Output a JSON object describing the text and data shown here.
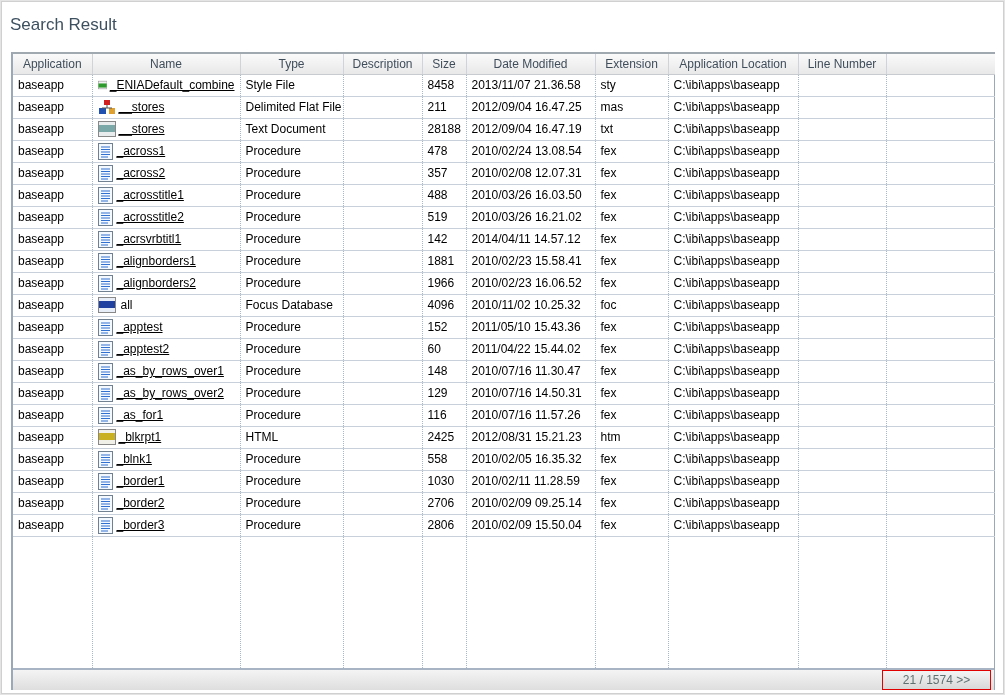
{
  "title": "Search Result",
  "table": {
    "columns": [
      "Application",
      "Name",
      "Type",
      "Description",
      "Size",
      "Date Modified",
      "Extension",
      "Application Location",
      "Line Number"
    ],
    "rows": [
      {
        "kind": "style",
        "linked": true,
        "cells": [
          "baseapp",
          "_ENIADefault_combine",
          "Style File",
          "",
          "8458",
          "2013/11/07 21.36.58",
          "sty",
          "C:\\ibi\\apps\\baseapp",
          ""
        ]
      },
      {
        "kind": "master",
        "linked": true,
        "cells": [
          "baseapp",
          "__stores",
          "Delimited Flat File",
          "",
          "211",
          "2012/09/04 16.47.25",
          "mas",
          "C:\\ibi\\apps\\baseapp",
          ""
        ]
      },
      {
        "kind": "text",
        "linked": true,
        "cells": [
          "baseapp",
          "__stores",
          "Text Document",
          "",
          "28188",
          "2012/09/04 16.47.19",
          "txt",
          "C:\\ibi\\apps\\baseapp",
          ""
        ]
      },
      {
        "kind": "procedure",
        "linked": true,
        "cells": [
          "baseapp",
          "_across1",
          "Procedure",
          "",
          "478",
          "2010/02/24 13.08.54",
          "fex",
          "C:\\ibi\\apps\\baseapp",
          ""
        ]
      },
      {
        "kind": "procedure",
        "linked": true,
        "cells": [
          "baseapp",
          "_across2",
          "Procedure",
          "",
          "357",
          "2010/02/08 12.07.31",
          "fex",
          "C:\\ibi\\apps\\baseapp",
          ""
        ]
      },
      {
        "kind": "procedure",
        "linked": true,
        "cells": [
          "baseapp",
          "_acrosstitle1",
          "Procedure",
          "",
          "488",
          "2010/03/26 16.03.50",
          "fex",
          "C:\\ibi\\apps\\baseapp",
          ""
        ]
      },
      {
        "kind": "procedure",
        "linked": true,
        "cells": [
          "baseapp",
          "_acrosstitle2",
          "Procedure",
          "",
          "519",
          "2010/03/26 16.21.02",
          "fex",
          "C:\\ibi\\apps\\baseapp",
          ""
        ]
      },
      {
        "kind": "procedure",
        "linked": true,
        "cells": [
          "baseapp",
          "_acrsvrbtitl1",
          "Procedure",
          "",
          "142",
          "2014/04/11 14.57.12",
          "fex",
          "C:\\ibi\\apps\\baseapp",
          ""
        ]
      },
      {
        "kind": "procedure",
        "linked": true,
        "cells": [
          "baseapp",
          "_alignborders1",
          "Procedure",
          "",
          "1881",
          "2010/02/23 15.58.41",
          "fex",
          "C:\\ibi\\apps\\baseapp",
          ""
        ]
      },
      {
        "kind": "procedure",
        "linked": true,
        "cells": [
          "baseapp",
          "_alignborders2",
          "Procedure",
          "",
          "1966",
          "2010/02/23 16.06.52",
          "fex",
          "C:\\ibi\\apps\\baseapp",
          ""
        ]
      },
      {
        "kind": "focus",
        "linked": false,
        "cells": [
          "baseapp",
          "all",
          "Focus Database",
          "",
          "4096",
          "2010/11/02 10.25.32",
          "foc",
          "C:\\ibi\\apps\\baseapp",
          ""
        ]
      },
      {
        "kind": "procedure",
        "linked": true,
        "cells": [
          "baseapp",
          "_apptest",
          "Procedure",
          "",
          "152",
          "2011/05/10 15.43.36",
          "fex",
          "C:\\ibi\\apps\\baseapp",
          ""
        ]
      },
      {
        "kind": "procedure",
        "linked": true,
        "cells": [
          "baseapp",
          "_apptest2",
          "Procedure",
          "",
          "60",
          "2011/04/22 15.44.02",
          "fex",
          "C:\\ibi\\apps\\baseapp",
          ""
        ]
      },
      {
        "kind": "procedure",
        "linked": true,
        "cells": [
          "baseapp",
          "_as_by_rows_over1",
          "Procedure",
          "",
          "148",
          "2010/07/16 11.30.47",
          "fex",
          "C:\\ibi\\apps\\baseapp",
          ""
        ]
      },
      {
        "kind": "procedure",
        "linked": true,
        "cells": [
          "baseapp",
          "_as_by_rows_over2",
          "Procedure",
          "",
          "129",
          "2010/07/16 14.50.31",
          "fex",
          "C:\\ibi\\apps\\baseapp",
          ""
        ]
      },
      {
        "kind": "procedure",
        "linked": true,
        "cells": [
          "baseapp",
          "_as_for1",
          "Procedure",
          "",
          "116",
          "2010/07/16 11.57.26",
          "fex",
          "C:\\ibi\\apps\\baseapp",
          ""
        ]
      },
      {
        "kind": "html",
        "linked": true,
        "cells": [
          "baseapp",
          "_blkrpt1",
          "HTML",
          "",
          "2425",
          "2012/08/31 15.21.23",
          "htm",
          "C:\\ibi\\apps\\baseapp",
          ""
        ]
      },
      {
        "kind": "procedure",
        "linked": true,
        "cells": [
          "baseapp",
          "_blnk1",
          "Procedure",
          "",
          "558",
          "2010/02/05 16.35.32",
          "fex",
          "C:\\ibi\\apps\\baseapp",
          ""
        ]
      },
      {
        "kind": "procedure",
        "linked": true,
        "cells": [
          "baseapp",
          "_border1",
          "Procedure",
          "",
          "1030",
          "2010/02/11 11.28.59",
          "fex",
          "C:\\ibi\\apps\\baseapp",
          ""
        ]
      },
      {
        "kind": "procedure",
        "linked": true,
        "cells": [
          "baseapp",
          "_border2",
          "Procedure",
          "",
          "2706",
          "2010/02/09 09.25.14",
          "fex",
          "C:\\ibi\\apps\\baseapp",
          ""
        ]
      },
      {
        "kind": "procedure",
        "linked": true,
        "cells": [
          "baseapp",
          "_border3",
          "Procedure",
          "",
          "2806",
          "2010/02/09 15.50.04",
          "fex",
          "C:\\ibi\\apps\\baseapp",
          ""
        ]
      }
    ]
  },
  "pager": "21 / 1574 >>"
}
